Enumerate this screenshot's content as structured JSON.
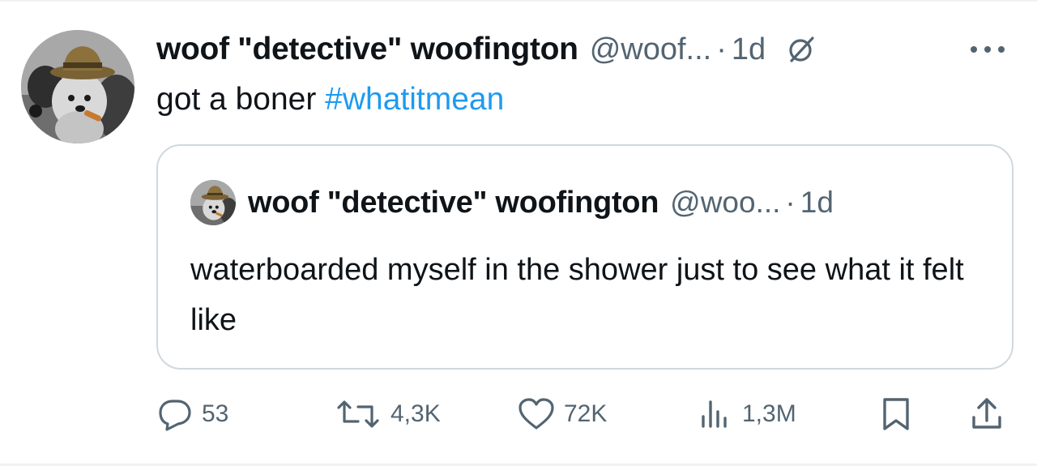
{
  "tweet": {
    "display_name": "woof \"detective\" woofington",
    "handle": "@woof...",
    "separator": "·",
    "time": "1d",
    "text": "got a boner",
    "hashtag": "#whatitmean"
  },
  "quote": {
    "display_name": "woof \"detective\" woofington",
    "handle": "@woo...",
    "separator": "·",
    "time": "1d",
    "text": "waterboarded myself in the shower just to see what it felt like"
  },
  "actions": {
    "replies": "53",
    "reposts": "4,3K",
    "likes": "72K",
    "views": "1,3M"
  },
  "icons": {
    "reply": "reply-icon",
    "repost": "repost-icon",
    "like": "heart-icon",
    "views": "views-icon",
    "bookmark": "bookmark-icon",
    "share": "share-icon",
    "grok": "grok-icon",
    "more": "more-icon"
  },
  "colors": {
    "text": "#0f1419",
    "secondary": "#536471",
    "accent": "#1d9bf0",
    "border": "#cfd9de"
  }
}
